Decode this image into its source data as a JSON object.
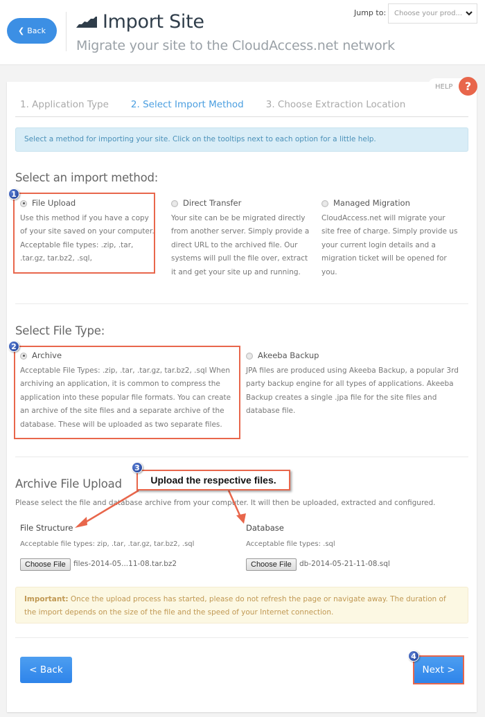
{
  "header": {
    "back_label": "Back",
    "title": "Import Site",
    "subtitle": "Migrate your site to the CloudAccess.net network",
    "jump_label": "Jump to:",
    "jump_select_value": "Choose your prod..."
  },
  "help": {
    "label": "HELP",
    "icon": "?"
  },
  "steps": [
    {
      "label": "1. Application Type",
      "active": false
    },
    {
      "label": "2. Select Import Method",
      "active": true
    },
    {
      "label": "3. Choose Extraction Location",
      "active": false
    }
  ],
  "info_alert": "Select a method for importing your site. Click on the tooltips next to each option for a little help.",
  "import_method": {
    "heading": "Select an import method:",
    "options": [
      {
        "title": "File Upload",
        "checked": true,
        "description": "Use this method if you have a copy of your site saved on your computer. Acceptable file types: .zip, .tar, .tar.gz, tar.bz2, .sql,"
      },
      {
        "title": "Direct Transfer",
        "checked": false,
        "description": "Your site can be be migrated directly from another server. Simply provide a direct URL to the archived file. Our systems will pull the file over, extract it and get your site up and running."
      },
      {
        "title": "Managed Migration",
        "checked": false,
        "description": "CloudAccess.net will migrate your site free of charge. Simply provide us your current login details and a migration ticket will be opened for you."
      }
    ]
  },
  "file_type": {
    "heading": "Select File Type:",
    "options": [
      {
        "title": "Archive",
        "checked": true,
        "description": "Acceptable File Types: .zip, .tar, .tar.gz, tar.bz2, .sql When archiving an application, it is common to compress the application into these popular file formats. You can create an archive of the site files and a separate archive of the database. These will be uploaded as two separate files."
      },
      {
        "title": "Akeeba Backup",
        "checked": false,
        "description": "JPA files are produced using Akeeba Backup, a popular 3rd party backup engine for all types of applications. Akeeba Backup creates a single .jpa file for the site files and database file."
      }
    ]
  },
  "upload": {
    "heading": "Archive File Upload",
    "description": "Please select the file and database archive from your computer. It will then be uploaded, extracted and configured.",
    "file_structure": {
      "label": "File Structure",
      "accepted": "Acceptable file types: zip, .tar, .tar.gz, tar.bz2, .sql",
      "button": "Choose File",
      "file_name": "files-2014-05...11-08.tar.bz2"
    },
    "database": {
      "label": "Database",
      "accepted": "Acceptable file types: .sql",
      "button": "Choose File",
      "file_name": "db-2014-05-21-11-08.sql"
    }
  },
  "warning": {
    "strong": "Important:",
    "text": " Once the upload process has started, please do not refresh the page or navigate away. The duration of the import depends on the size of the file and the speed of your Internet connection."
  },
  "annotations": {
    "badges": [
      "1",
      "2",
      "3",
      "4"
    ],
    "callout": "Upload the respective files."
  },
  "footer": {
    "back_label": "< Back",
    "next_label": "Next >"
  },
  "colors": {
    "accent": "#3c8fe4",
    "highlight": "#e8664b",
    "active_step": "#4a9ee0"
  }
}
